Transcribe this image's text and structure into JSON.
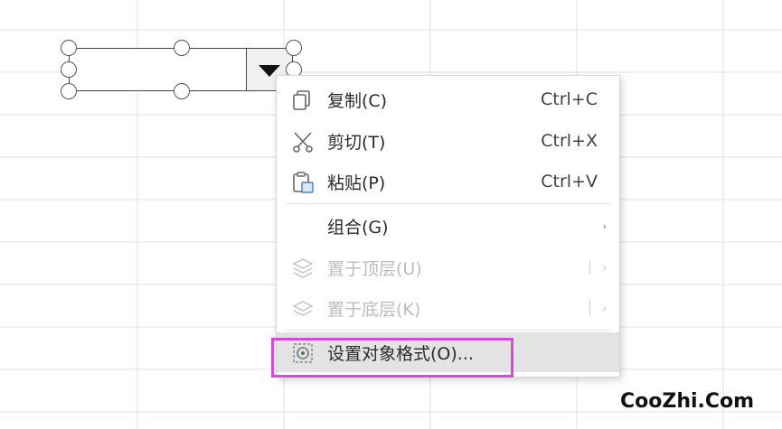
{
  "context_menu": {
    "items": [
      {
        "label": "复制(C)",
        "shortcut": "Ctrl+C",
        "icon": "copy-icon",
        "enabled": true
      },
      {
        "label": "剪切(T)",
        "shortcut": "Ctrl+X",
        "icon": "scissors-icon",
        "enabled": true
      },
      {
        "label": "粘贴(P)",
        "shortcut": "Ctrl+V",
        "icon": "paste-icon",
        "enabled": true
      },
      {
        "label": "组合(G)",
        "has_submenu": true,
        "enabled": true
      },
      {
        "label": "置于顶层(U)",
        "has_submenu": true,
        "icon": "bring-to-front-icon",
        "enabled": false
      },
      {
        "label": "置于底层(K)",
        "has_submenu": true,
        "icon": "send-to-back-icon",
        "enabled": false
      },
      {
        "label": "设置对象格式(O)...",
        "icon": "format-object-icon",
        "enabled": true,
        "highlighted": true
      }
    ],
    "submenu_arrow": "›"
  },
  "combo_box": {
    "dropdown_icon": "triangle-down-icon"
  },
  "colors": {
    "highlight_border": "#d54ad8",
    "hover_bg": "#e3e3e3",
    "gridline": "#e0e0e0"
  },
  "watermark": "CooZhi.Com"
}
